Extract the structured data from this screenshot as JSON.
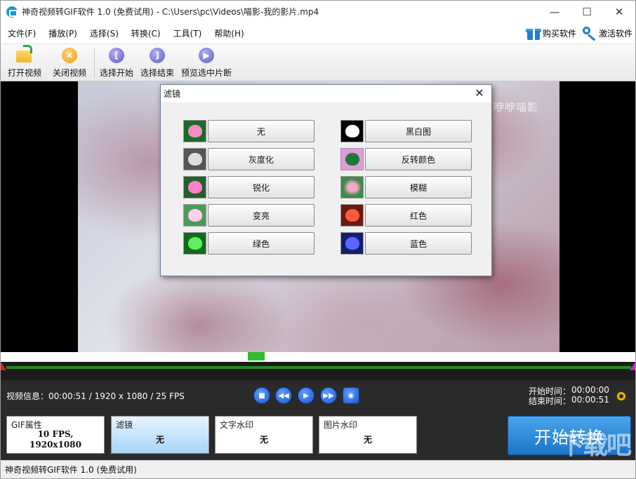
{
  "window": {
    "title": "神奇视频转GIF软件 1.0 (免费试用) - C:\\Users\\pc\\Videos\\喵影-我的影片.mp4",
    "minimize": "—",
    "maximize": "☐",
    "close": "✕"
  },
  "menu": {
    "items": [
      "文件(F)",
      "播放(P)",
      "选择(S)",
      "转换(C)",
      "工具(T)",
      "帮助(H)"
    ],
    "buy": "购买软件",
    "activate": "激活软件"
  },
  "toolbar": {
    "open_video": "打开视频",
    "close_video": "关闭视频",
    "select_start": "选择开始",
    "select_end": "选择结束",
    "preview_segment": "预览选中片断"
  },
  "video": {
    "overlay_text": "咿咿喵影"
  },
  "dialog": {
    "title": "滤镜",
    "close": "✕",
    "filters_left": [
      "无",
      "灰度化",
      "锐化",
      "变亮",
      "绿色"
    ],
    "filters_right": [
      "黑白图",
      "反转颜色",
      "模糊",
      "红色",
      "蓝色"
    ]
  },
  "controls": {
    "info": "视频信息：00:00:51 / 1920 x 1080 / 25 FPS",
    "start_time_label": "开始时间：",
    "start_time": "00:00:00",
    "end_time_label": "结束时间：",
    "end_time": "00:00:51"
  },
  "panels": {
    "gif_label": "GIF属性",
    "gif_fps": "10 FPS,",
    "gif_size": "1920x1080",
    "filter_label": "滤镜",
    "filter_value": "无",
    "text_wm_label": "文字水印",
    "text_wm_value": "无",
    "image_wm_label": "图片水印",
    "image_wm_value": "无",
    "start_convert": "开始转换"
  },
  "status": {
    "text": "神奇视频转GIF软件 1.0 (免费试用)"
  },
  "corner_watermark": "下载吧",
  "colors": {
    "accent_blue": "#1a74c9",
    "scrub_green": "#2fbf2f",
    "dark_bg": "#2a2a2a"
  }
}
